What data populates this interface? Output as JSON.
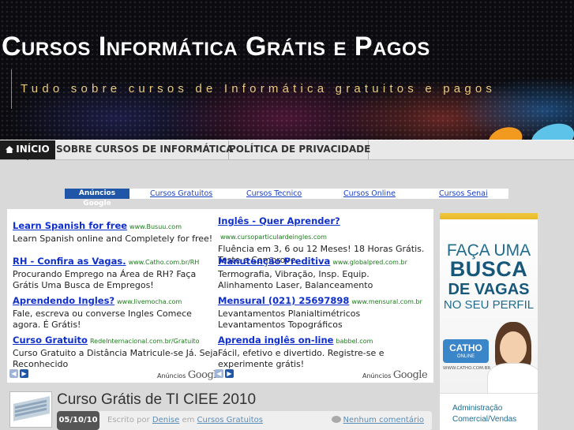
{
  "header": {
    "site_title": "Cursos Informática Grátis e Pagos",
    "tagline": "Tudo sobre cursos de Informática gratuitos e pagos"
  },
  "nav": {
    "items": [
      {
        "label": "INÍCIO",
        "active": true
      },
      {
        "label": "SOBRE CURSOS DE INFORMÁTICA"
      },
      {
        "label": "POLÍTICA DE PRIVACIDADE"
      }
    ]
  },
  "link_bar": {
    "tag": "Anúncios Google",
    "links": [
      "Cursos Gratuitos",
      "Cursos Tecnico",
      "Cursos Online",
      "Cursos Senai"
    ]
  },
  "ads": {
    "left": [
      {
        "title": "Learn Spanish for free",
        "url": "www.Busuu.com",
        "text": "Learn Spanish online and Completely for free!"
      },
      {
        "title": "RH - Confira as Vagas.",
        "url": "www.Catho.com.br/RH",
        "text": "Procurando Emprego na Área de RH? Faça Grátis Uma Busca de Empregos!"
      },
      {
        "title": "Aprendendo Ingles?",
        "url": "www.livemocha.com",
        "text": "Fale, escreva ou converse Ingles Comece agora. É Grátis!"
      },
      {
        "title": "Curso Gratuito",
        "url": "RedeInternacional.com.br/Gratuito",
        "text": "Curso Gratuito a Distância Matricule-se Já. Seja Reconhecido"
      }
    ],
    "right": [
      {
        "title": "Inglês - Quer Aprender?",
        "url": "www.cursoparticulardeingles.com",
        "text": "Fluência em 3, 6 ou 12 Meses! 18 Horas Grátis. Teste e Comprove."
      },
      {
        "title": "Manutenção Preditiva",
        "url": "www.globalpred.com.br",
        "text": "Termografia, Vibração, Insp. Equip. Alinhamento Laser, Balanceamento"
      },
      {
        "title": "Mensural (021) 25697898",
        "url": "www.mensural.com.br",
        "text": "Levantamentos Planialtimétricos Levantamentos Topográficos"
      },
      {
        "title": "Aprenda inglês on-line",
        "url": "babbel.com",
        "text": "Fácil, efetivo e divertido. Registre-se e experimente grátis!"
      }
    ],
    "ads_by_label": "Anúncios",
    "ads_by_brand": "Google"
  },
  "banner": {
    "line1": "FAÇA UMA",
    "line2": "BUSCA",
    "line3": "DE VAGAS",
    "line4": "NO SEU PERFIL",
    "logo": "CATHO",
    "logo_sub": "ONLINE",
    "logo_url": "WWW.CATHO.COM.BR",
    "bottom_line1": "Administração",
    "bottom_line2": "Comercial/Vendas"
  },
  "post": {
    "title": "Curso Grátis de TI CIEE 2010",
    "date": "05/10/10",
    "written_by": "Escrito por",
    "author": "Denise",
    "in": "em",
    "category": "Cursos Gratuitos",
    "comments": "Nenhum comentário"
  },
  "colors": {
    "nav_active": "#1d1d1d",
    "ad_title": "#1030cc",
    "ad_url": "#1a7a1a",
    "tagline": "#e8c97a",
    "google_blue": "#1f56a7"
  }
}
